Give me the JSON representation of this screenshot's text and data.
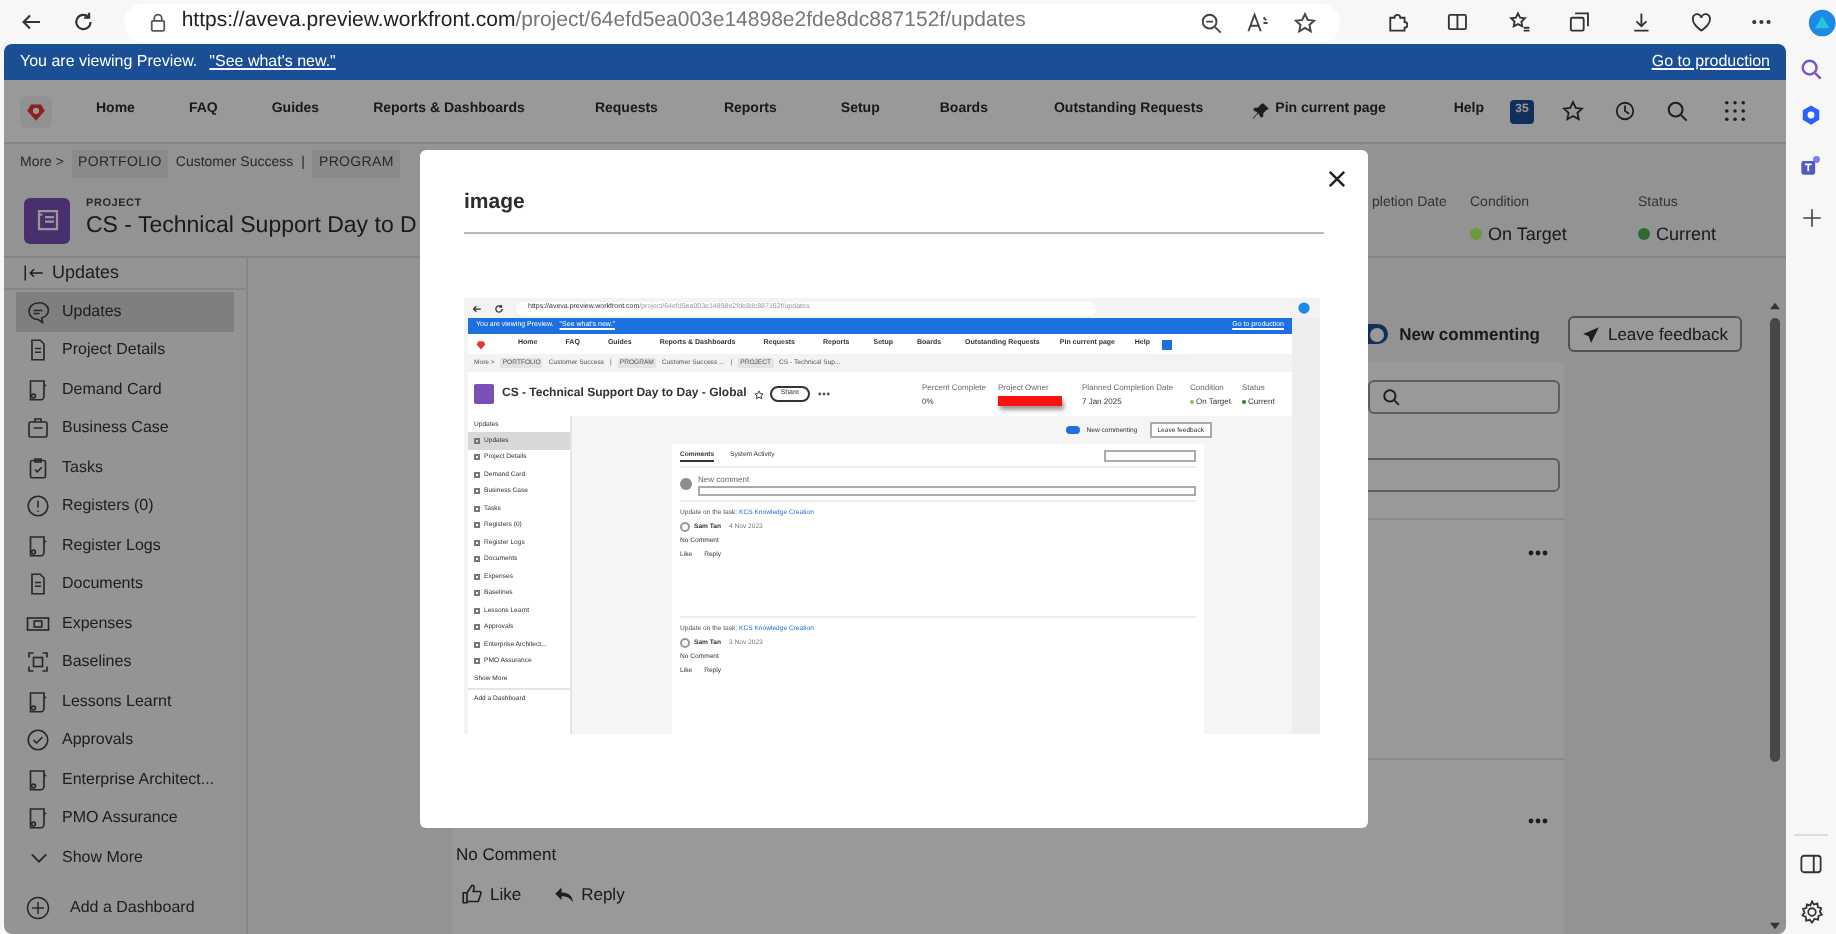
{
  "browser": {
    "url_host": "https://aveva.preview.workfront.com",
    "url_path": "/project/64efd5ea003e14898e2fde8dc887152f/updates"
  },
  "banner": {
    "message": "You are viewing Preview.",
    "link": "\"See what's new.\"",
    "action": "Go to production"
  },
  "nav": {
    "items": [
      "Home",
      "FAQ",
      "Guides",
      "Reports & Dashboards",
      "Requests",
      "Reports",
      "Setup",
      "Boards",
      "Outstanding Requests"
    ],
    "pin": "Pin current page",
    "help": "Help",
    "badge": "35"
  },
  "breadcrumb": [
    {
      "text": "More >",
      "kind": "link"
    },
    {
      "text": "PORTFOLIO",
      "kind": "tag"
    },
    {
      "text": "Customer Success",
      "kind": "link"
    },
    {
      "text": "|",
      "kind": "sep"
    },
    {
      "text": "PROGRAM",
      "kind": "tag"
    }
  ],
  "project": {
    "label": "PROJECT",
    "title": "CS - Technical Support Day to D"
  },
  "fields": [
    {
      "label": "pletion Date"
    },
    {
      "label": "Condition",
      "value": "On Target",
      "color": "#6a9a3a"
    },
    {
      "label": "Status",
      "value": "Current",
      "color": "#2e6b30"
    }
  ],
  "sidebar": {
    "header": "Updates",
    "items": [
      {
        "label": "Updates",
        "kind": "chat",
        "selected": true
      },
      {
        "label": "Project Details",
        "kind": "doc",
        "selected": false
      },
      {
        "label": "Demand Card",
        "kind": "card",
        "selected": false
      },
      {
        "label": "Business Case",
        "kind": "case",
        "selected": false
      },
      {
        "label": "Tasks",
        "kind": "task",
        "selected": false
      },
      {
        "label": "Registers (0)",
        "kind": "alert",
        "selected": false
      },
      {
        "label": "Register Logs",
        "kind": "card",
        "selected": false
      },
      {
        "label": "Documents",
        "kind": "doc",
        "selected": false
      },
      {
        "label": "Expenses",
        "kind": "expense",
        "selected": false
      },
      {
        "label": "Baselines",
        "kind": "baseline",
        "selected": false
      },
      {
        "label": "Lessons Learnt",
        "kind": "card",
        "selected": false
      },
      {
        "label": "Approvals",
        "kind": "check",
        "selected": false
      },
      {
        "label": "Enterprise Architect...",
        "kind": "card",
        "selected": false
      },
      {
        "label": "PMO Assurance",
        "kind": "card",
        "selected": false
      }
    ],
    "show_more": "Show More",
    "add_dashboard": "Add a Dashboard"
  },
  "commenting": {
    "label": "New commenting",
    "on": true,
    "feedback": "Leave feedback"
  },
  "comment": {
    "text": "No Comment",
    "like": "Like",
    "reply": "Reply"
  },
  "modal": {
    "title": "image",
    "screenshot": {
      "url_host": "https://aveva.preview.workfront.com",
      "url_path": "/project/64efd5ea003e14898e2fde8dc887152f/updates",
      "banner": "You are viewing Preview.",
      "banner_link": "\"See what's new.\"",
      "banner_action": "Go to production",
      "nav": [
        "Home",
        "FAQ",
        "Guides",
        "Reports & Dashboards",
        "Requests",
        "Reports",
        "Setup",
        "Boards",
        "Outstanding Requests"
      ],
      "pin": "Pin current page",
      "help": "Help",
      "breadcrumb": [
        {
          "text": "More >",
          "kind": "link"
        },
        {
          "text": "PORTFOLIO",
          "kind": "tag"
        },
        {
          "text": "Customer Success",
          "kind": "link"
        },
        {
          "text": "|",
          "kind": "sep"
        },
        {
          "text": "PROGRAM",
          "kind": "tag"
        },
        {
          "text": "Customer Success ...",
          "kind": "link"
        },
        {
          "text": "|",
          "kind": "sep"
        },
        {
          "text": "PROJECT",
          "kind": "tag"
        },
        {
          "text": "CS - Technical Sup...",
          "kind": "link"
        }
      ],
      "title": "CS - Technical Support Day to Day - Global",
      "share": "Share",
      "fields": [
        {
          "label": "Percent Complete",
          "value": "0%",
          "kind": "text"
        },
        {
          "label": "Project Owner",
          "kind": "redacted"
        },
        {
          "label": "Planned Completion Date",
          "value": "7 Jan 2025",
          "kind": "text"
        },
        {
          "label": "Condition",
          "value": "On Target",
          "kind": "status",
          "color": "#8bc34a"
        },
        {
          "label": "Status",
          "value": "Current",
          "kind": "status",
          "color": "#2e7d32"
        }
      ],
      "sidebar_header": "Updates",
      "sidebar": [
        {
          "label": "Updates",
          "selected": true
        },
        {
          "label": "Project Details",
          "selected": false
        },
        {
          "label": "Demand Card",
          "selected": false
        },
        {
          "label": "Business Case",
          "selected": false
        },
        {
          "label": "Tasks",
          "selected": false
        },
        {
          "label": "Registers (0)",
          "selected": false
        },
        {
          "label": "Register Logs",
          "selected": false
        },
        {
          "label": "Documents",
          "selected": false
        },
        {
          "label": "Expenses",
          "selected": false
        },
        {
          "label": "Baselines",
          "selected": false
        },
        {
          "label": "Lessons Learnt",
          "selected": false
        },
        {
          "label": "Approvals",
          "selected": false
        },
        {
          "label": "Enterprise Architect...",
          "selected": false
        },
        {
          "label": "PMO Assurance",
          "selected": false
        }
      ],
      "show_more": "Show More",
      "add_dashboard": "Add a Dashboard",
      "commenting": "New commenting",
      "commenting_on": true,
      "feedback": "Leave feedback",
      "tabs": [
        {
          "label": "Comments",
          "selected": true
        },
        {
          "label": "System Activity",
          "selected": false
        }
      ],
      "new_comment": "New comment",
      "updates": [
        {
          "prefix": "Update on the task:",
          "task": "KCS Knowledge Creation",
          "author": "Sam Tan",
          "date": "4 Nov 2023",
          "text": "No Comment",
          "like": "Like",
          "reply": "Reply"
        },
        {
          "prefix": "Update on the task:",
          "task": "KCS Knowledge Creation",
          "author": "Sam Tan",
          "date": "3 Nov 2023",
          "text": "No Comment",
          "like": "Like",
          "reply": "Reply"
        }
      ]
    }
  }
}
